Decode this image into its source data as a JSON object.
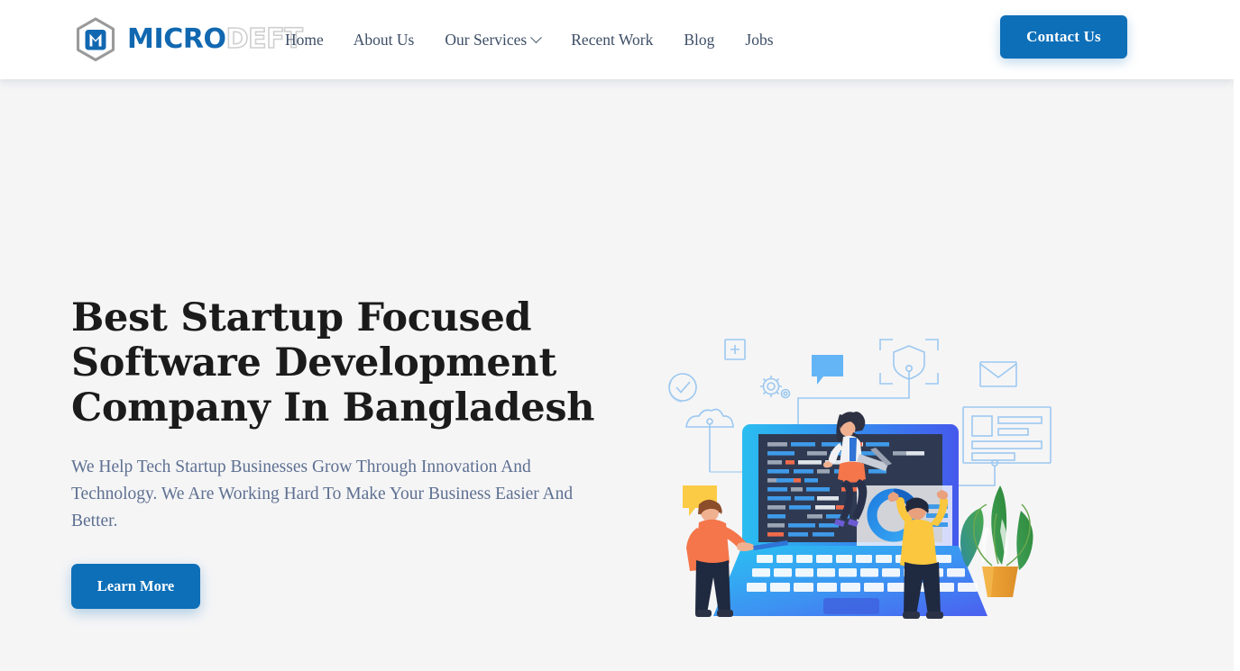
{
  "header": {
    "logo": {
      "icon": "hexagon-monogram-icon",
      "text_primary": "MICRO",
      "text_secondary": "DEFT"
    },
    "nav": [
      {
        "label": "Home",
        "has_dropdown": false
      },
      {
        "label": "About Us",
        "has_dropdown": false
      },
      {
        "label": "Our Services",
        "has_dropdown": true,
        "dropdown_icon": "chevron-down-icon"
      },
      {
        "label": "Recent Work",
        "has_dropdown": false
      },
      {
        "label": "Blog",
        "has_dropdown": false
      },
      {
        "label": "Jobs",
        "has_dropdown": false
      }
    ],
    "cta": {
      "label": "Contact Us"
    }
  },
  "hero": {
    "title": "Best Startup Focused Software Development Company In Bangladesh",
    "subtitle": "We Help Tech Startup Businesses Grow Through Innovation And Technology. We Are Working Hard To Make Your Business Easier And Better.",
    "cta": {
      "label": "Learn More"
    },
    "illustration": {
      "name": "software-development-team-illustration",
      "elements": [
        "plus-square-icon",
        "check-circle-icon",
        "gear-icon",
        "cloud-icon",
        "chat-bubble-icon",
        "shield-icon",
        "envelope-icon",
        "document-card-icon",
        "laptop-with-code-editor",
        "woman-with-laptop-figure",
        "man-pointing-figure",
        "man-with-donut-chart-figure",
        "potted-plant"
      ]
    }
  },
  "colors": {
    "brand_blue": "#0d6fb8",
    "logo_blue": "#1168b0",
    "logo_gray": "#cfcfcf",
    "nav_text": "#3d4e66",
    "heading": "#1b1b1b",
    "body_text": "#5e7091",
    "page_background": "#f5f5f6",
    "header_background": "#ffffff",
    "code_screen": "#2f3a52",
    "laptop_base": "#3d8ef4",
    "accent_orange": "#f4805e",
    "accent_yellow": "#f9c23c",
    "plant_green": "#3f9e4d"
  }
}
